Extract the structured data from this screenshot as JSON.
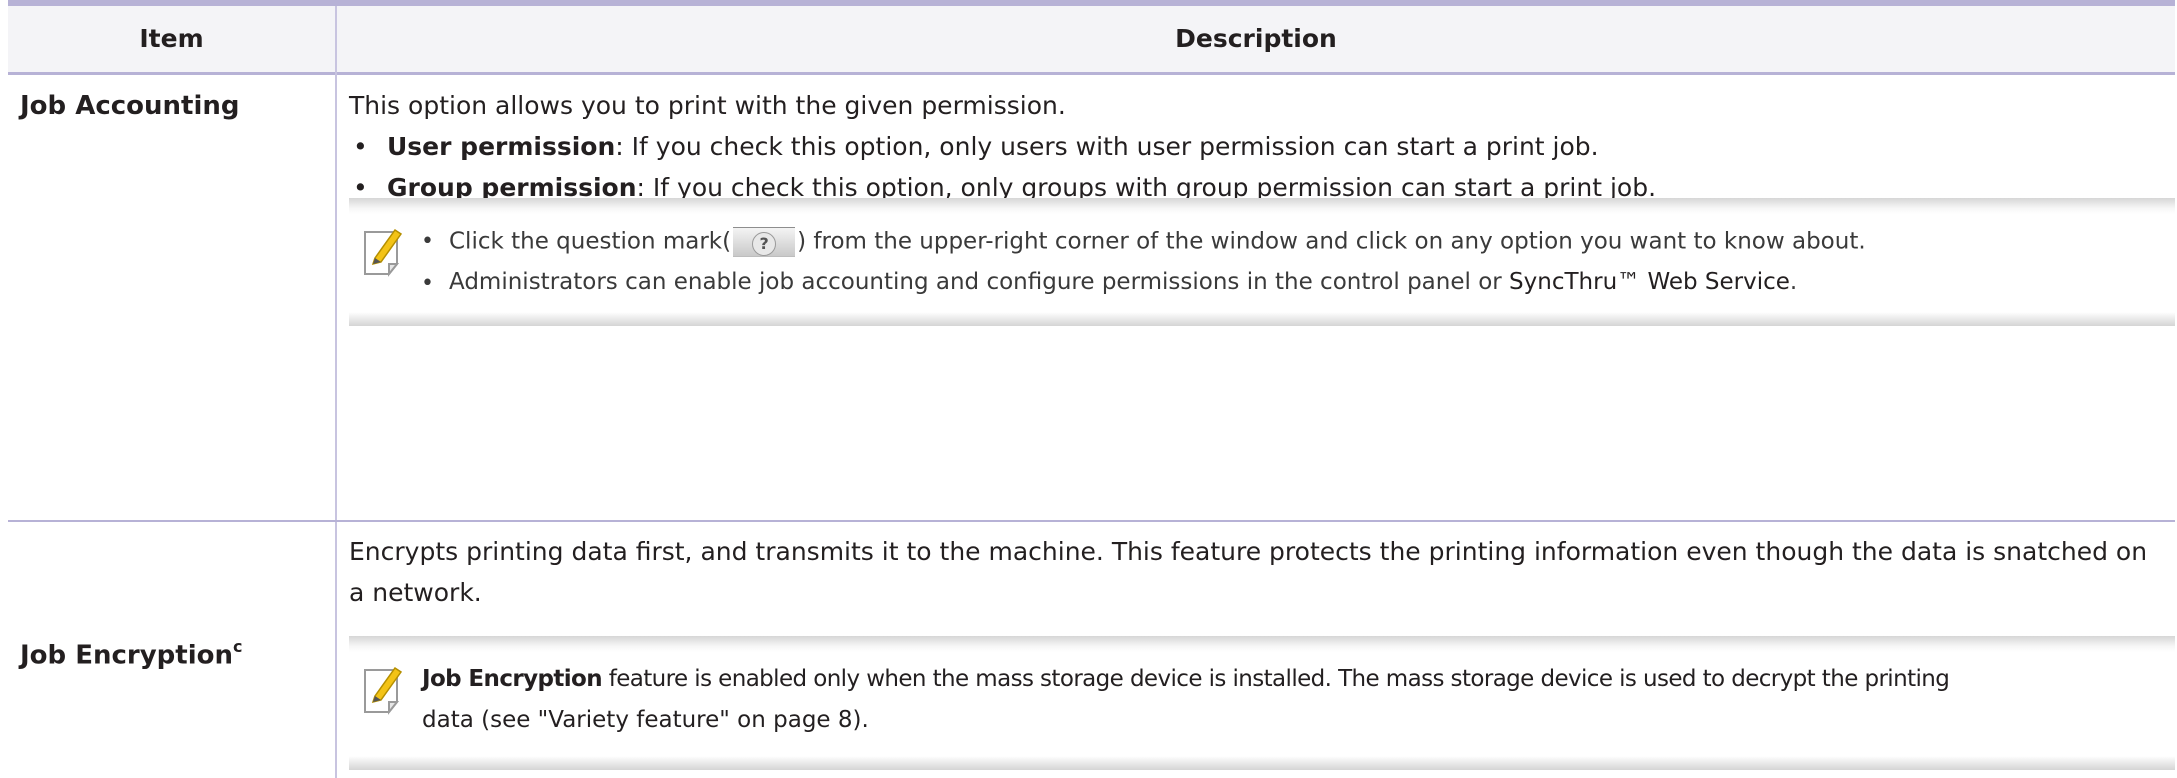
{
  "header": {
    "item": "Item",
    "description": "Description"
  },
  "rows": [
    {
      "item": "Job Accounting",
      "intro": "This option allows you to print with the given permission.",
      "bullets": [
        {
          "term": "User permission",
          "text": ": If you check this option, only users with user permission can start a print job."
        },
        {
          "term": "Group permission",
          "text": ": If you check this option, only groups with group permission can start a print job."
        }
      ],
      "note": {
        "icon": "note-pencil-icon",
        "line1_before": "Click the question mark(",
        "button_glyph": "?",
        "line1_after": ") from the upper-right corner of the window and click on any option you want to know about.",
        "line2_before": "Administrators can enable job accounting and configure permissions in the control panel or ",
        "line2_link": "SyncThru™ Web Service",
        "line2_after": "."
      }
    },
    {
      "item": "Job Encryption",
      "item_sup": "c",
      "intro_line1": "Encrypts printing data first, and transmits it to the machine. This feature protects the printing information even though the data is snatched on",
      "intro_line2": "a network.",
      "note": {
        "icon": "note-pencil-icon",
        "term": "Job Encryption",
        "line1": " feature is enabled only when the mass storage device is installed. The mass storage device is used to decrypt the printing",
        "line2": "data (see \"Variety feature\" on page 8)."
      }
    }
  ]
}
